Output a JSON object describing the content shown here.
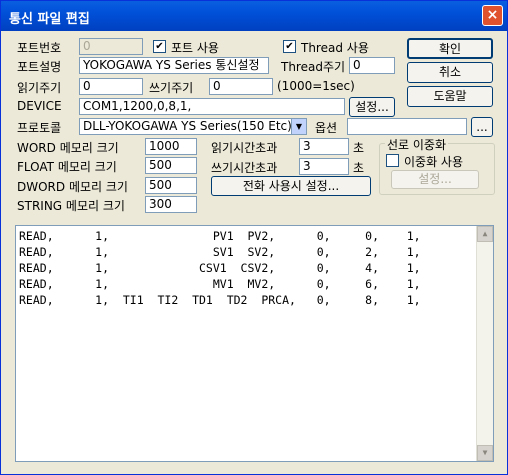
{
  "window": {
    "title": "통신 파일 편집",
    "close": "×"
  },
  "port": {
    "number_label": "포트번호",
    "number_value": "0",
    "use_label": "포트 사용",
    "use_checked": true,
    "thread_use_label": "Thread 사용",
    "thread_use_checked": true,
    "desc_label": "포트설명",
    "desc_value": "YOKOGAWA YS Series 통신설정",
    "thread_period_label": "Thread주기",
    "thread_period_value": "0",
    "read_period_label": "읽기주기",
    "read_period_value": "0",
    "write_period_label": "쓰기주기",
    "write_period_value": "0",
    "period_note": "(1000=1sec)",
    "device_label": "DEVICE",
    "device_value": "COM1,1200,0,8,1,",
    "device_setup": "설정...",
    "protocol_label": "프로토콜",
    "protocol_value": "DLL-YOKOGAWA YS Series(150 Etc)",
    "option_label": "옵션",
    "option_value": "",
    "option_browse": "..."
  },
  "memory": {
    "word_label": "WORD 메모리 크기",
    "word_value": "1000",
    "float_label": "FLOAT 메모리 크기",
    "float_value": "500",
    "dword_label": "DWORD 메모리 크기",
    "dword_value": "500",
    "string_label": "STRING 메모리 크기",
    "string_value": "300"
  },
  "timeout": {
    "read_label": "읽기시간초과",
    "read_value": "3",
    "read_unit": "초",
    "write_label": "쓰기시간초과",
    "write_value": "3",
    "write_unit": "초",
    "phone_setup": "전화 사용시 설정..."
  },
  "redundancy": {
    "group_label": "선로 이중화",
    "use_label": "이중화 사용",
    "use_checked": false,
    "setup": "설정..."
  },
  "buttons": {
    "ok": "확인",
    "cancel": "취소",
    "help": "도움말"
  },
  "script_lines": [
    "READ,      1,               PV1  PV2,      0,     0,    1,",
    "READ,      1,               SV1  SV2,      0,     2,    1,",
    "READ,      1,             CSV1  CSV2,      0,     4,    1,",
    "READ,      1,               MV1  MV2,      0,     6,    1,",
    "READ,      1,  TI1  TI2  TD1  TD2  PRCA,   0,     8,    1,"
  ]
}
